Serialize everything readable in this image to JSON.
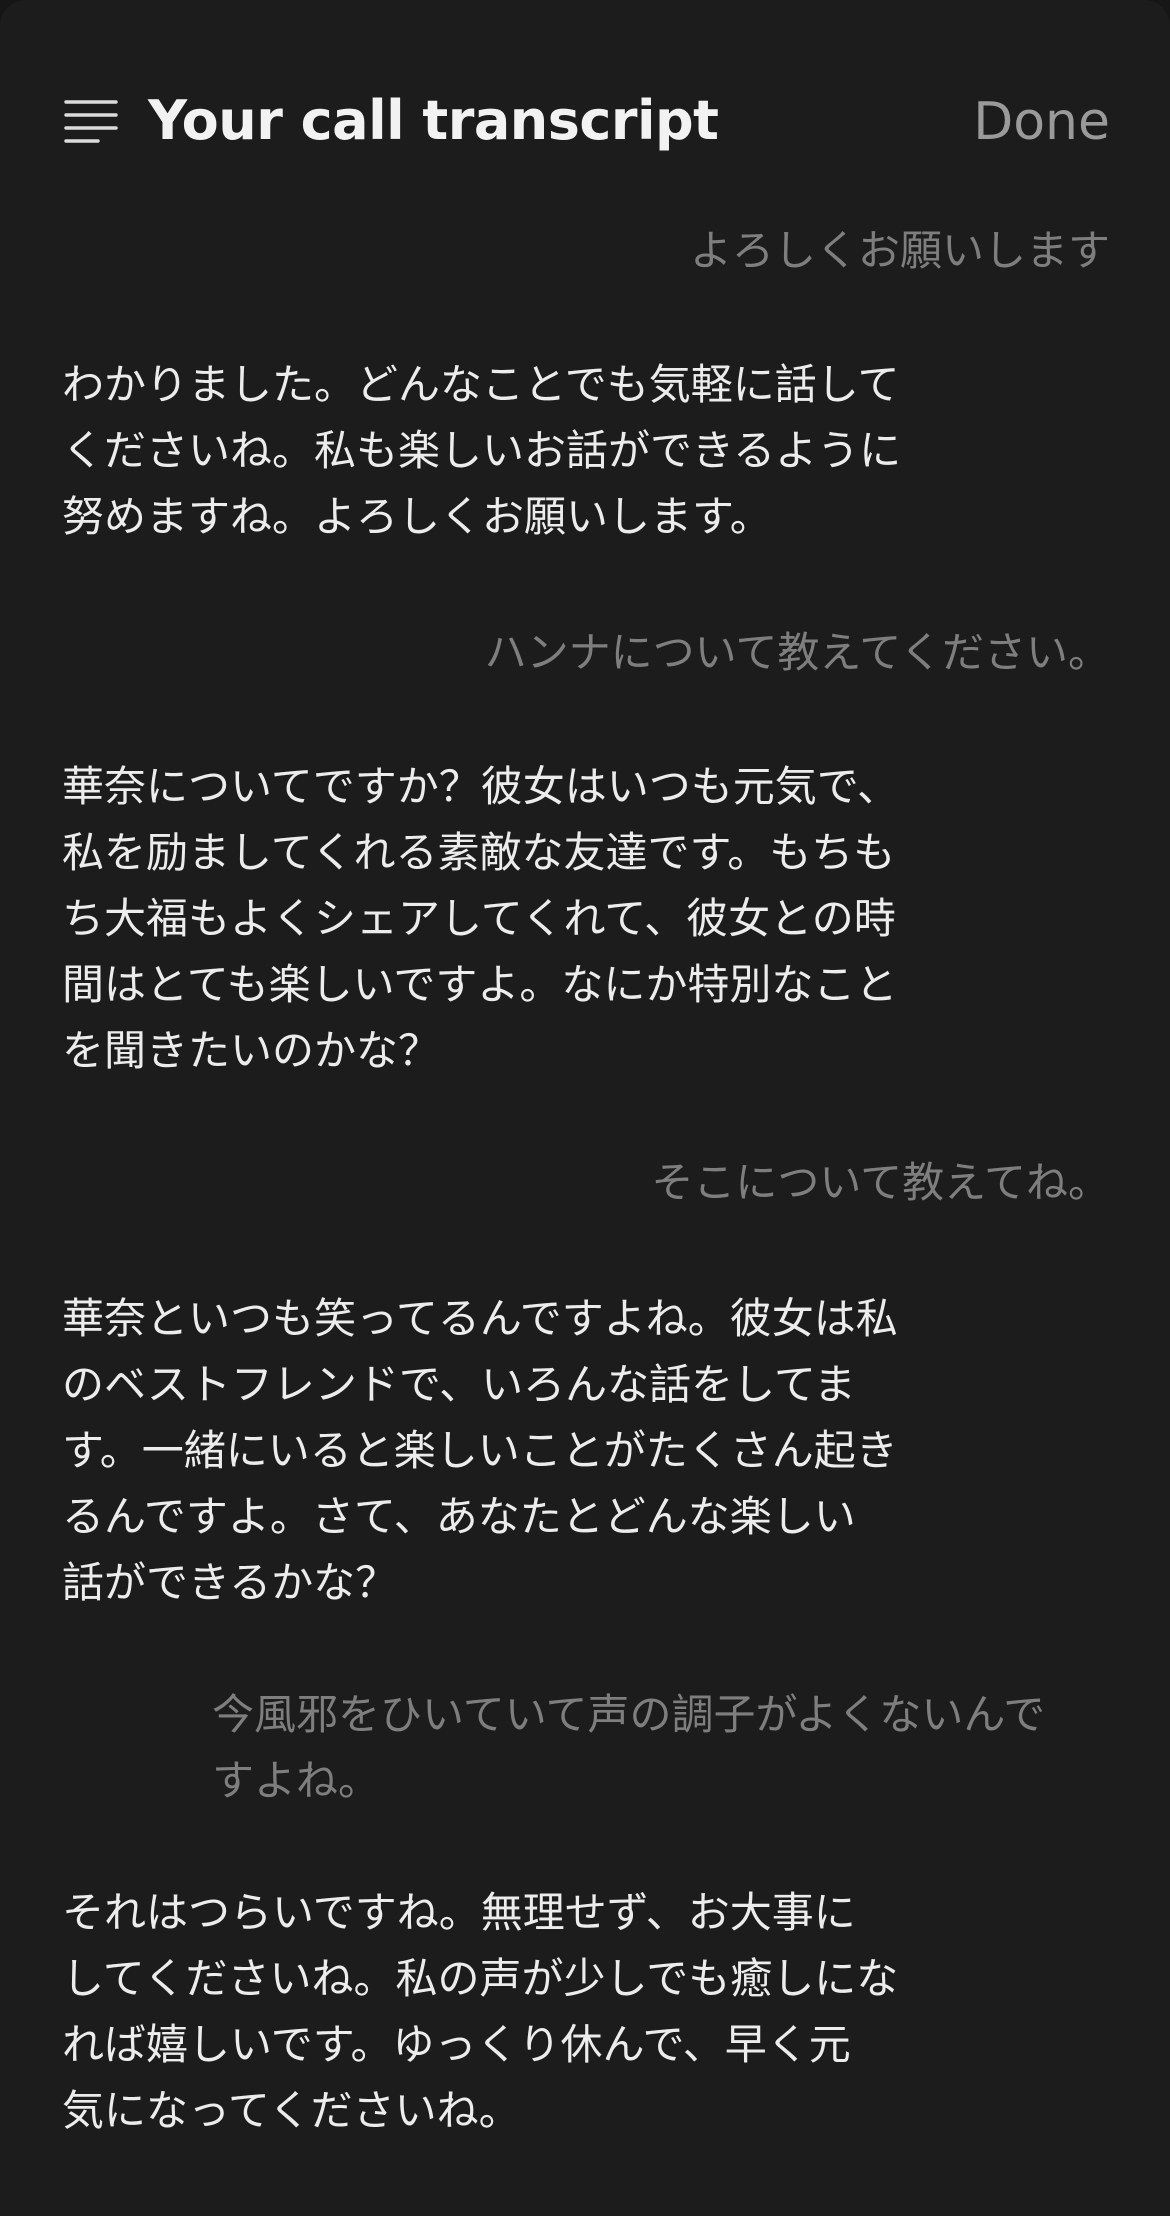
{
  "header": {
    "title": "Your call transcript",
    "done_label": "Done",
    "menu_icon": "menu-lines-icon"
  },
  "colors": {
    "background": "#1c1c1c",
    "title": "#f2f2f2",
    "user_text": "#7e7e7e",
    "assistant_text": "#ececec",
    "done": "#9a9a9a"
  },
  "messages": [
    {
      "role": "user",
      "text": "よろしくお願いします"
    },
    {
      "role": "assistant",
      "text": "わかりました。どんなことでも気軽に話して\nくださいね。私も楽しいお話ができるように\n努めますね。よろしくお願いします。"
    },
    {
      "role": "user",
      "text": "ハンナについて教えてください。"
    },
    {
      "role": "assistant",
      "text": "華奈についてですか？彼女はいつも元気で、\n私を励ましてくれる素敵な友達です。もちも\nち大福もよくシェアしてくれて、彼女との時\n間はとても楽しいですよ。なにか特別なこと\nを聞きたいのかな？"
    },
    {
      "role": "user",
      "text": "そこについて教えてね。"
    },
    {
      "role": "assistant",
      "text": "華奈といつも笑ってるんですよね。彼女は私\nのベストフレンドで、いろんな話をしてま\nす。一緒にいると楽しいことがたくさん起き\nるんですよ。さて、あなたとどんな楽しい\n話ができるかな？"
    },
    {
      "role": "user",
      "text": "今風邪をひいていて声の調子がよくないんで\nすよね。"
    },
    {
      "role": "assistant",
      "text": "それはつらいですね。無理せず、お大事に\nしてくださいね。私の声が少しでも癒しにな\nれば嬉しいです。ゆっくり休んで、早く元\n気になってくださいね。"
    }
  ]
}
